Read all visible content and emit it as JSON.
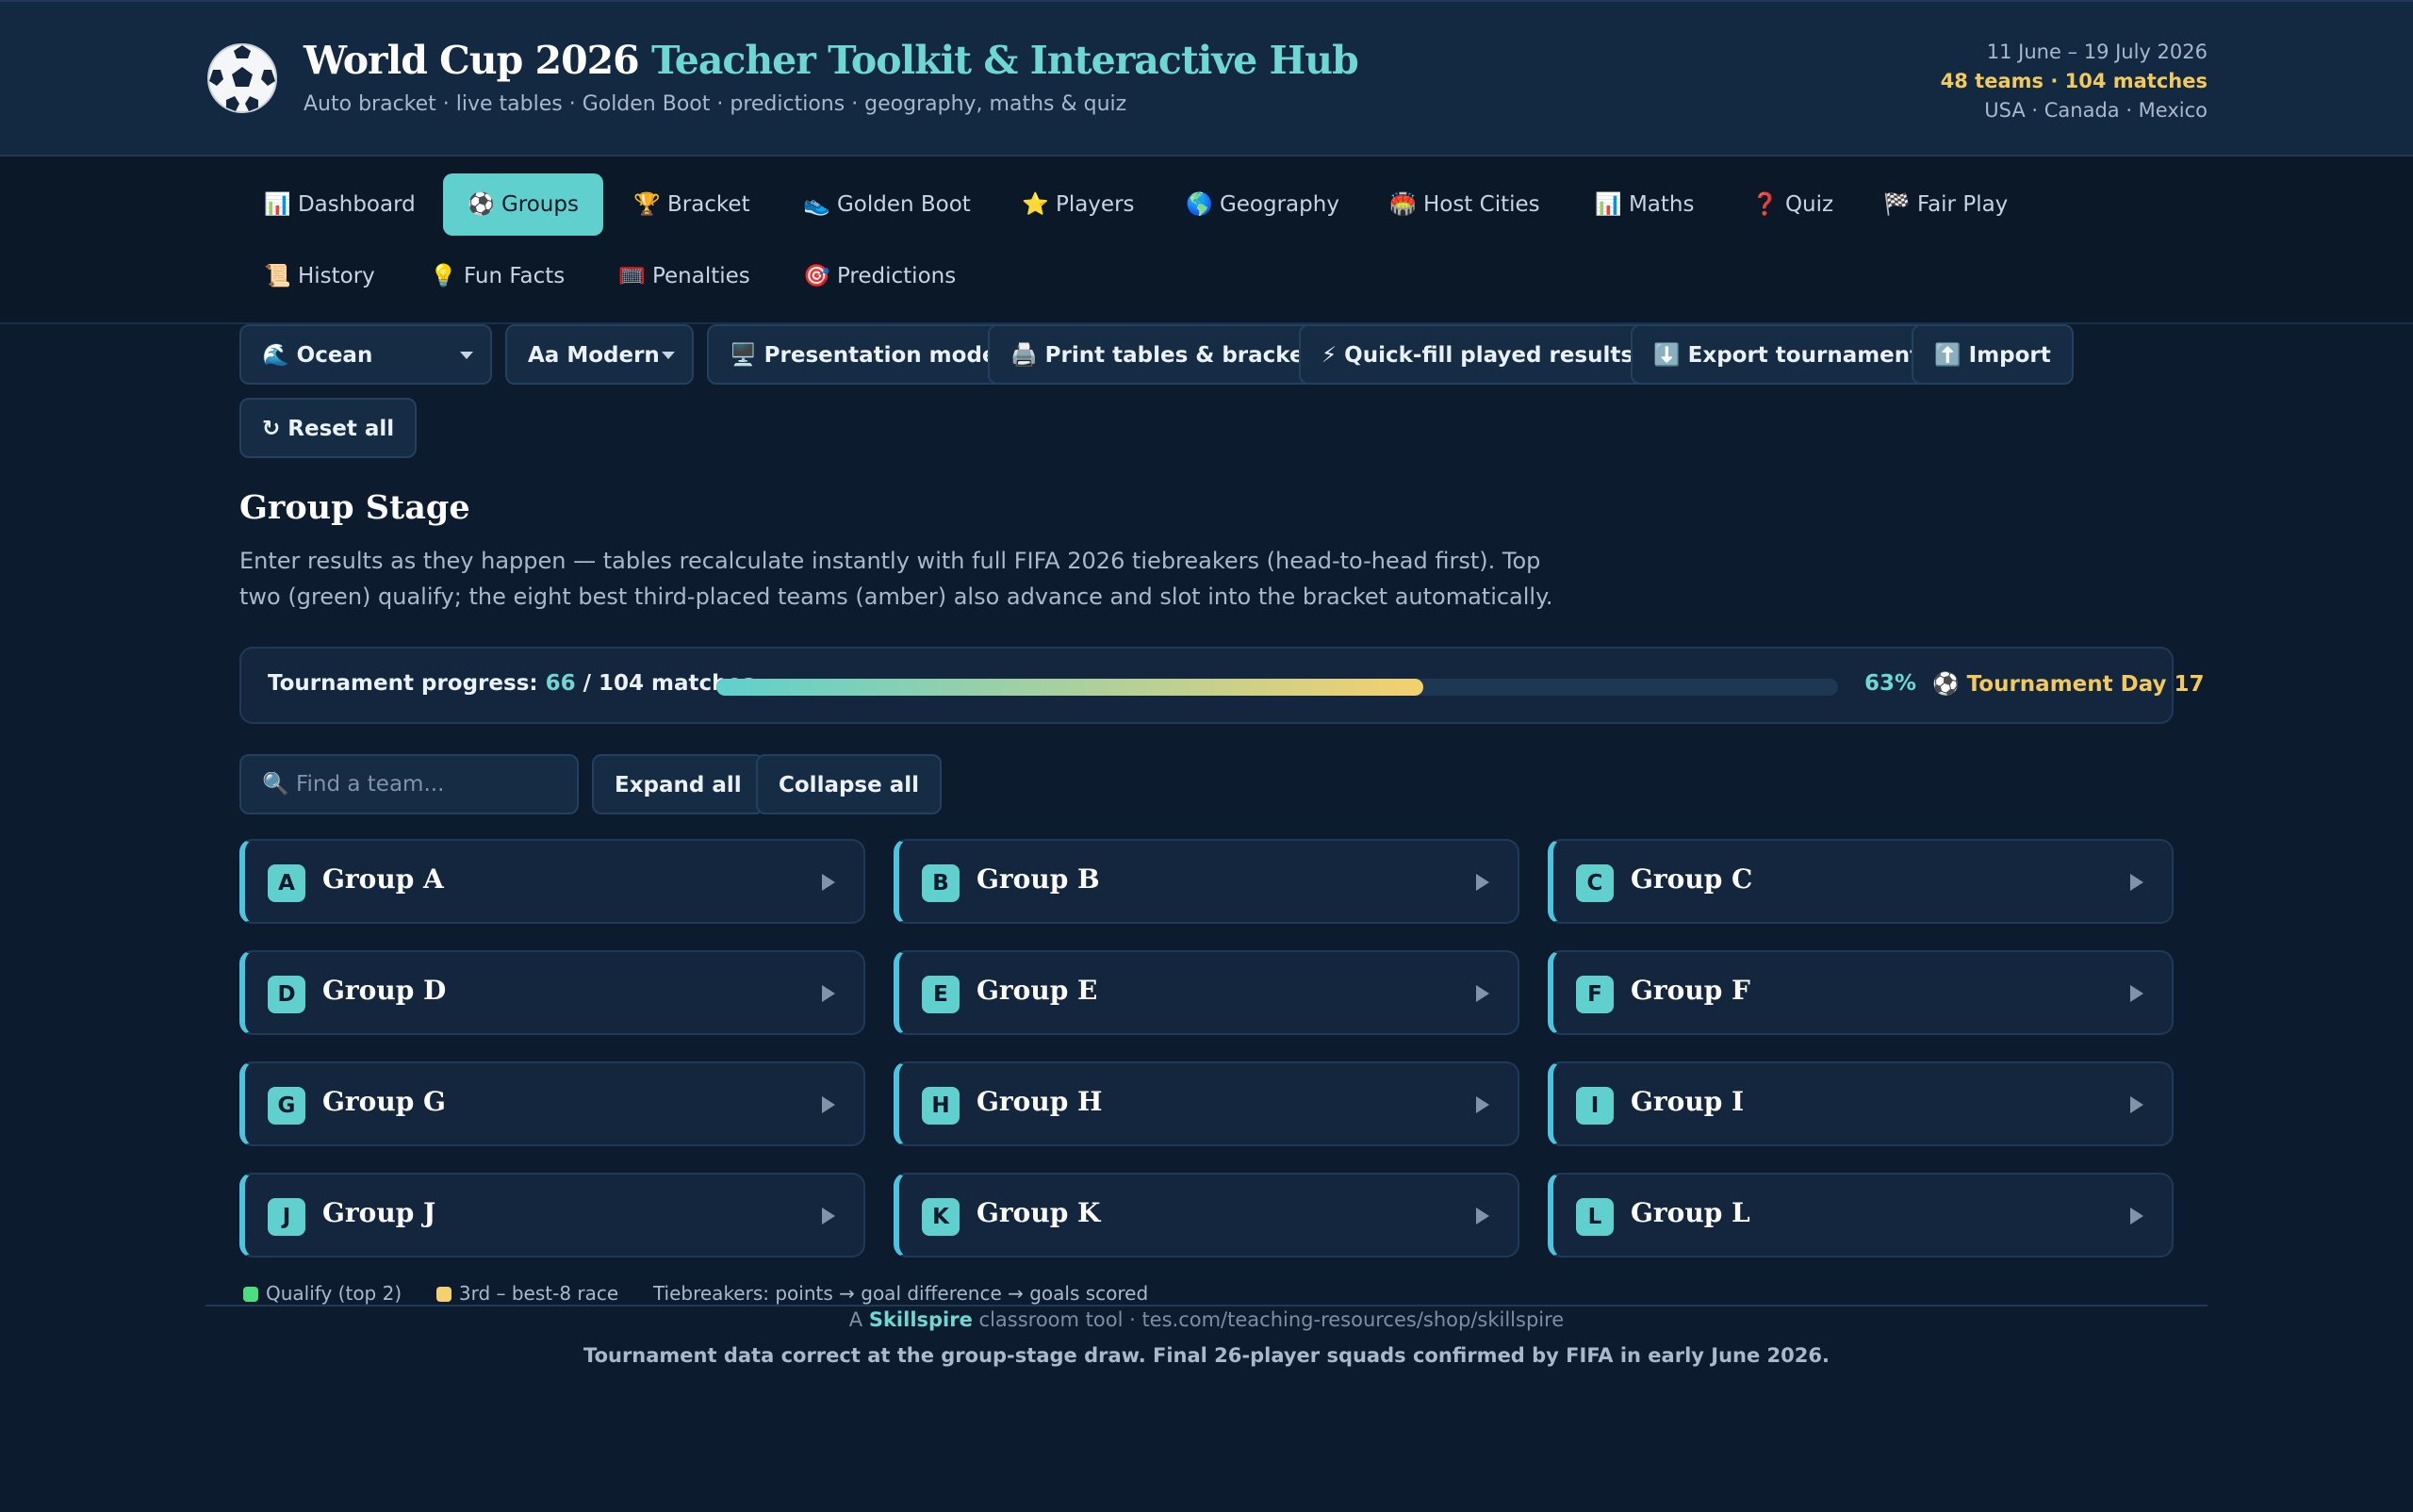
{
  "header": {
    "title_part1": "World Cup 2026 ",
    "title_part2": "Teacher Toolkit & Interactive Hub",
    "subtitle": "Auto bracket · live tables · Golden Boot · predictions · geography, maths & quiz",
    "dates": "11 June – 19 July 2026",
    "stats": "48 teams · 104 matches",
    "hosts": "USA · Canada · Mexico"
  },
  "nav": {
    "tabs": [
      {
        "icon": "📊",
        "label": "Dashboard"
      },
      {
        "icon": "⚽",
        "label": "Groups",
        "active": true
      },
      {
        "icon": "🏆",
        "label": "Bracket"
      },
      {
        "icon": "👟",
        "label": "Golden Boot"
      },
      {
        "icon": "⭐",
        "label": "Players"
      },
      {
        "icon": "🌎",
        "label": "Geography"
      },
      {
        "icon": "🏟️",
        "label": "Host Cities"
      },
      {
        "icon": "📊",
        "label": "Maths"
      },
      {
        "icon": "❓",
        "label": "Quiz"
      },
      {
        "icon": "🏁",
        "label": "Fair Play"
      },
      {
        "icon": "📜",
        "label": "History"
      },
      {
        "icon": "💡",
        "label": "Fun Facts"
      },
      {
        "icon": "🥅",
        "label": "Penalties"
      },
      {
        "icon": "🎯",
        "label": "Predictions"
      }
    ]
  },
  "toolbar": {
    "theme": "🌊 Ocean",
    "font": "Aa Modern",
    "presentation": "🖥️ Presentation mode",
    "print": "🖨️ Print tables & bracket",
    "quickfill": "⚡ Quick-fill played results",
    "export": "⬇️ Export tournament",
    "import": "⬆️ Import",
    "reset": "↻ Reset all"
  },
  "section": {
    "title": "Group Stage",
    "description": "Enter results as they happen — tables recalculate instantly with full FIFA 2026 tiebreakers (head-to-head first). Top two (green) qualify; the eight best third-placed teams (amber) also advance and slot into the bracket automatically."
  },
  "progress": {
    "label": "Tournament progress: ",
    "played": "66",
    "total_text": " / 104 matches",
    "fraction": 0.63,
    "percent": "63%",
    "day": "⚽ Tournament Day 17"
  },
  "controls": {
    "search_placeholder": "🔍 Find a team...",
    "expand": "Expand all",
    "collapse": "Collapse all"
  },
  "groups": [
    {
      "letter": "A",
      "name": "Group A"
    },
    {
      "letter": "B",
      "name": "Group B"
    },
    {
      "letter": "C",
      "name": "Group C"
    },
    {
      "letter": "D",
      "name": "Group D"
    },
    {
      "letter": "E",
      "name": "Group E"
    },
    {
      "letter": "F",
      "name": "Group F"
    },
    {
      "letter": "G",
      "name": "Group G"
    },
    {
      "letter": "H",
      "name": "Group H"
    },
    {
      "letter": "I",
      "name": "Group I"
    },
    {
      "letter": "J",
      "name": "Group J"
    },
    {
      "letter": "K",
      "name": "Group K"
    },
    {
      "letter": "L",
      "name": "Group L"
    }
  ],
  "legend": {
    "qualify": "Qualify (top 2)",
    "third": "3rd – best-8 race",
    "tiebreakers": "Tiebreakers: points → goal difference → goals scored",
    "qualify_color": "#4ade80",
    "third_color": "#f4d06f"
  },
  "footer": {
    "prefix": "A ",
    "brand": "Skillspire",
    "suffix": " classroom tool · tes.com/teaching-resources/shop/skillspire",
    "note": "Tournament data correct at the group-stage draw. Final 26-player squads confirmed by FIFA in early June 2026."
  },
  "colors": {
    "accent": "#5fd0cd",
    "gold": "#f2c95c",
    "background": "#0d1b2e"
  }
}
